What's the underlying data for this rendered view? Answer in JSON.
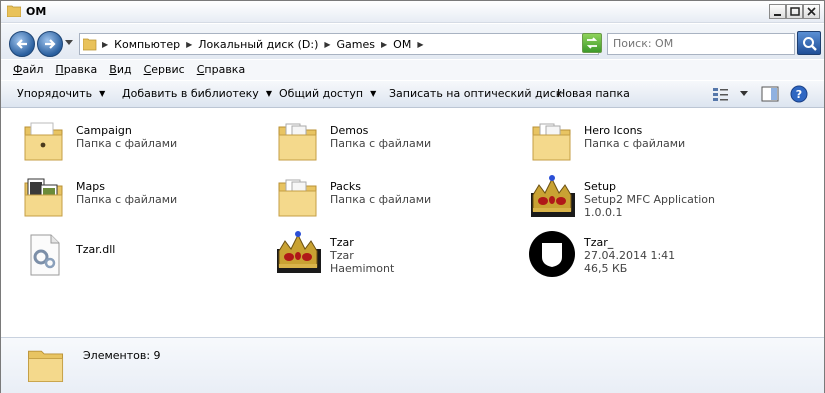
{
  "window": {
    "title": "OM"
  },
  "nav": {
    "crumbs": [
      "Компьютер",
      "Локальный диск (D:)",
      "Games",
      "OM"
    ],
    "search_placeholder": "Поиск: OM"
  },
  "menu": [
    "Файл",
    "Правка",
    "Вид",
    "Сервис",
    "Справка"
  ],
  "toolbar": {
    "organize": "Упорядочить",
    "add_library": "Добавить в библиотеку",
    "share": "Общий доступ",
    "burn": "Записать на оптический диск",
    "new_folder": "Новая папка"
  },
  "items": [
    {
      "name": "Campaign",
      "l2": "Папка с файлами",
      "l3": "",
      "icon": "folder-icon"
    },
    {
      "name": "Demos",
      "l2": "Папка с файлами",
      "l3": "",
      "icon": "folder-icon"
    },
    {
      "name": "Hero Icons",
      "l2": "Папка с файлами",
      "l3": "",
      "icon": "folder-icon"
    },
    {
      "name": "Maps",
      "l2": "Папка с файлами",
      "l3": "",
      "icon": "folder-icon"
    },
    {
      "name": "Packs",
      "l2": "Папка с файлами",
      "l3": "",
      "icon": "folder-icon"
    },
    {
      "name": "Setup",
      "l2": "Setup2 MFC Application",
      "l3": "1.0.0.1",
      "icon": "crown-icon"
    },
    {
      "name": "Tzar.dll",
      "l2": "",
      "l3": "",
      "icon": "dll-file-icon"
    },
    {
      "name": "Tzar",
      "l2": "Tzar",
      "l3": "Haemimont",
      "icon": "crown-icon"
    },
    {
      "name": "Tzar_",
      "l2": "27.04.2014 1:41",
      "l3": "46,5 КБ",
      "icon": "shield-file-icon"
    }
  ],
  "details": {
    "count": "Элементов: 9"
  },
  "colors": {
    "folder": "#f3d27a",
    "accent": "#2a5f9e"
  }
}
